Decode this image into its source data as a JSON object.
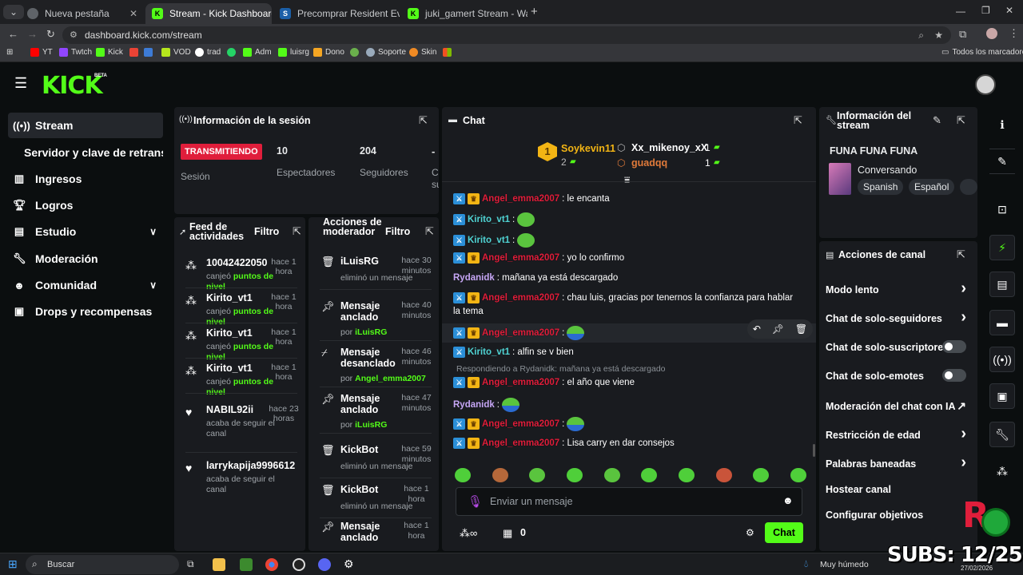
{
  "browser": {
    "tabs": [
      {
        "title": "Nueva pestaña",
        "active": false
      },
      {
        "title": "Stream - Kick Dashboard",
        "active": true
      },
      {
        "title": "Precomprar Resident Evil Requ",
        "active": false
      },
      {
        "title": "juki_gamert Stream - Watch Liv",
        "active": false
      }
    ],
    "url": "dashboard.kick.com/stream",
    "bookmarks": [
      "YT",
      "Twtch",
      "Kick",
      "VOD",
      "trad",
      "Adm",
      "luisrg",
      "Dono",
      "Soporte",
      "Skin"
    ],
    "all_bookmarks": "Todos los marcadores"
  },
  "header": {
    "logo": "KICK",
    "beta": "BETA"
  },
  "sidebar": [
    {
      "label": "Stream",
      "icon": "broadcast-icon"
    },
    {
      "label": "Servidor y clave de retransmisión",
      "icon": ""
    },
    {
      "label": "Ingresos",
      "icon": "chart-icon"
    },
    {
      "label": "Logros",
      "icon": "trophy-icon"
    },
    {
      "label": "Estudio",
      "icon": "studio-icon"
    },
    {
      "label": "Moderación",
      "icon": "wrench-icon"
    },
    {
      "label": "Comunidad",
      "icon": "community-icon"
    },
    {
      "label": "Drops y recompensas",
      "icon": "gift-icon"
    }
  ],
  "session": {
    "title": "Información de la sesión",
    "live_badge": "TRANSMITIENDO",
    "session_label": "Sesión",
    "viewers": "10",
    "viewers_label": "Espectadores",
    "followers": "204",
    "followers_label": "Seguidores",
    "extra_value": "-",
    "extra_label": "C\nsu"
  },
  "feed": {
    "title": "Feed de actividades",
    "filter": "Filtro",
    "items": [
      {
        "name": "10042422050",
        "time": "hace 1 hora",
        "action": "canjeó",
        "reward": "puntos de nivel"
      },
      {
        "name": "Kirito_vt1",
        "time": "hace 1 hora",
        "action": "canjeó",
        "reward": "puntos de nivel"
      },
      {
        "name": "Kirito_vt1",
        "time": "hace 1 hora",
        "action": "canjeó",
        "reward": "puntos de nivel"
      },
      {
        "name": "Kirito_vt1",
        "time": "hace 1 hora",
        "action": "canjeó",
        "reward": "puntos de nivel"
      },
      {
        "name": "NABIL92ii",
        "time": "hace 23 horas",
        "action": "acaba de seguir el canal",
        "reward": ""
      },
      {
        "name": "larrykapija9996612",
        "time": "",
        "action": "acaba de seguir el canal",
        "reward": ""
      }
    ]
  },
  "modactions": {
    "title": "Acciones de moderador",
    "filter": "Filtro",
    "items": [
      {
        "name": "iLuisRG",
        "time": "hace 30 minutos",
        "desc": "eliminó un mensaje",
        "by": "",
        "icon": "trash-icon"
      },
      {
        "name": "Mensaje anclado",
        "time": "hace 40 minutos",
        "desc": "por",
        "by": "iLuisRG",
        "icon": "pin-icon"
      },
      {
        "name": "Mensaje desanclado",
        "time": "hace 46 minutos",
        "desc": "por",
        "by": "Angel_emma2007",
        "icon": "unpin-icon"
      },
      {
        "name": "Mensaje anclado",
        "time": "hace 47 minutos",
        "desc": "por",
        "by": "iLuisRG",
        "icon": "pin-icon"
      },
      {
        "name": "KickBot",
        "time": "hace 59 minutos",
        "desc": "eliminó un mensaje",
        "by": "",
        "icon": "trash-icon"
      },
      {
        "name": "KickBot",
        "time": "hace 1 hora",
        "desc": "eliminó un mensaje",
        "by": "",
        "icon": "trash-icon"
      },
      {
        "name": "Mensaje anclado",
        "time": "hace 1 hora",
        "desc": "",
        "by": "",
        "icon": "pin-icon"
      }
    ]
  },
  "chat": {
    "title": "Chat",
    "leaders": [
      {
        "rank": "1",
        "name": "Soykevin11",
        "count": "2"
      },
      {
        "rank": "2",
        "name": "Xx_mikenoy_xX",
        "count": "1"
      },
      {
        "rank": "3",
        "name": "guadqq",
        "count": "1"
      }
    ],
    "messages": [
      {
        "user": "Angel_emma2007",
        "color": "red",
        "mod": true,
        "sub": true,
        "text": ": le encanta",
        "emote": false
      },
      {
        "user": "Kirito_vt1",
        "color": "cyan",
        "mod": true,
        "sub": false,
        "text": ":",
        "emote": true
      },
      {
        "user": "Kirito_vt1",
        "color": "cyan",
        "mod": true,
        "sub": false,
        "text": ":",
        "emote": true
      },
      {
        "user": "Angel_emma2007",
        "color": "red",
        "mod": true,
        "sub": true,
        "text": ": yo lo confirmo",
        "emote": false
      },
      {
        "user": "Rydanidk",
        "color": "purple",
        "mod": false,
        "sub": false,
        "text": ": mañana ya está descargado",
        "emote": false
      },
      {
        "user": "Angel_emma2007",
        "color": "red",
        "mod": true,
        "sub": true,
        "text": ": chau luis, gracias por tenernos la confianza para hablar",
        "emote": false
      },
      {
        "user": "",
        "color": "",
        "mod": false,
        "sub": false,
        "text": "la tema",
        "emote": false
      },
      {
        "user": "Angel_emma2007",
        "color": "red",
        "mod": true,
        "sub": true,
        "text": ":",
        "emote": true
      },
      {
        "user": "Kirito_vt1",
        "color": "cyan",
        "mod": true,
        "sub": false,
        "text": ": alfin se v bien",
        "emote": false
      },
      {
        "user": "",
        "color": "",
        "mod": false,
        "sub": false,
        "text": "Respondiendo a Rydanidk: mañana ya está descargado",
        "emote": false
      },
      {
        "user": "Angel_emma2007",
        "color": "red",
        "mod": true,
        "sub": true,
        "text": ": el año que viene",
        "emote": false
      },
      {
        "user": "Rydanidk",
        "color": "purple",
        "mod": false,
        "sub": false,
        "text": ":",
        "emote": true
      },
      {
        "user": "Angel_emma2007",
        "color": "red",
        "mod": true,
        "sub": true,
        "text": ":",
        "emote": true
      },
      {
        "user": "Angel_emma2007",
        "color": "red",
        "mod": true,
        "sub": true,
        "text": ": Lisa carry en dar consejos",
        "emote": false
      }
    ],
    "placeholder": "Enviar un mensaje",
    "points": "0",
    "send": "Chat"
  },
  "streaminfo": {
    "title": "Información del stream",
    "stream_title": "FUNA FUNA FUNA",
    "category": "Conversando",
    "tags": [
      "Spanish",
      "Español"
    ]
  },
  "channel_actions": {
    "title": "Acciones de canal",
    "items": [
      {
        "label": "Modo lento",
        "kind": "chevron"
      },
      {
        "label": "Chat de solo-seguidores",
        "kind": "chevron"
      },
      {
        "label": "Chat de solo-suscriptores",
        "kind": "toggle"
      },
      {
        "label": "Chat de solo-emotes",
        "kind": "toggle"
      },
      {
        "label": "Moderación del chat con IA",
        "kind": "external"
      },
      {
        "label": "Restricción de edad",
        "kind": "chevron"
      },
      {
        "label": "Palabras baneadas",
        "kind": "chevron"
      },
      {
        "label": "Hostear canal",
        "kind": "none"
      },
      {
        "label": "Configurar objetivos",
        "kind": "none"
      }
    ]
  },
  "overlay": {
    "subs": "SUBS: 12/25"
  },
  "taskbar": {
    "search": "Buscar",
    "weather": "Muy húmedo",
    "date": "27/02/2026"
  },
  "colors": {
    "kick_green": "#53fc18",
    "live_red": "#e01e3b"
  }
}
